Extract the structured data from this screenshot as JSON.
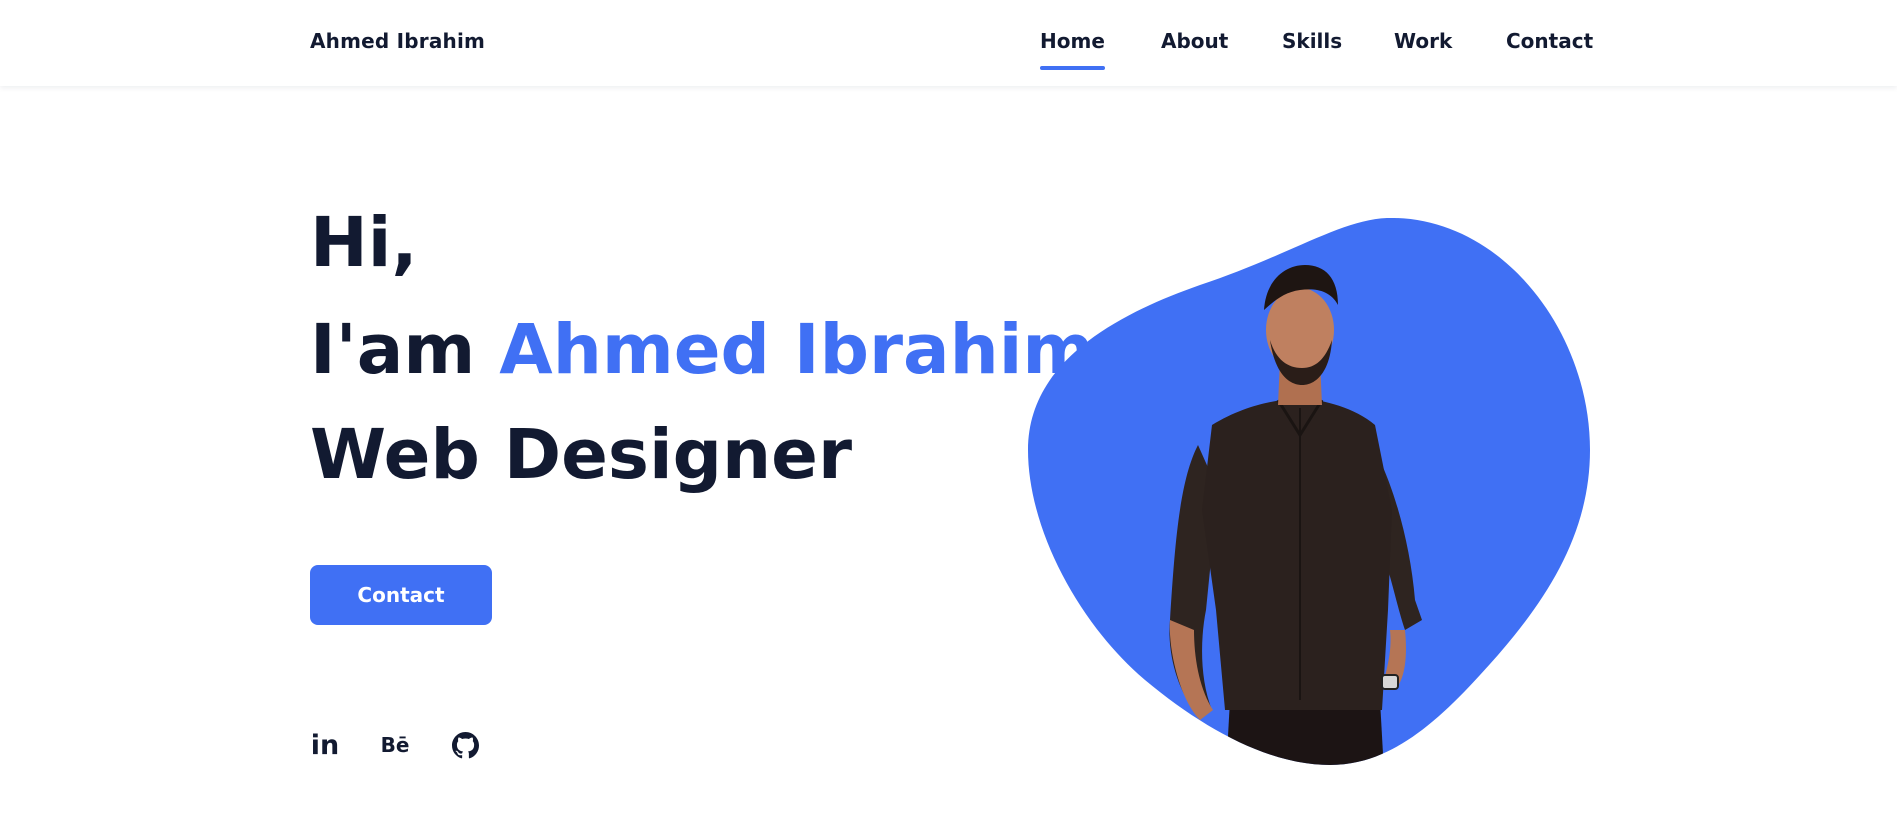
{
  "header": {
    "logo": "Ahmed Ibrahim",
    "nav": [
      {
        "label": "Home",
        "active": true
      },
      {
        "label": "About",
        "active": false
      },
      {
        "label": "Skills",
        "active": false
      },
      {
        "label": "Work",
        "active": false
      },
      {
        "label": "Contact",
        "active": false
      }
    ]
  },
  "hero": {
    "greeting": "Hi,",
    "intro_prefix": "I'am",
    "name": "Ahmed Ibrahim",
    "role": "Web Designer",
    "contact_button": "Contact"
  },
  "social": [
    {
      "icon": "linkedin-icon",
      "glyph": "in"
    },
    {
      "icon": "behance-icon",
      "glyph": "Bē"
    },
    {
      "icon": "github-icon",
      "glyph": ""
    }
  ],
  "colors": {
    "accent": "#4070f4",
    "text": "#121a31",
    "background": "#ffffff"
  }
}
